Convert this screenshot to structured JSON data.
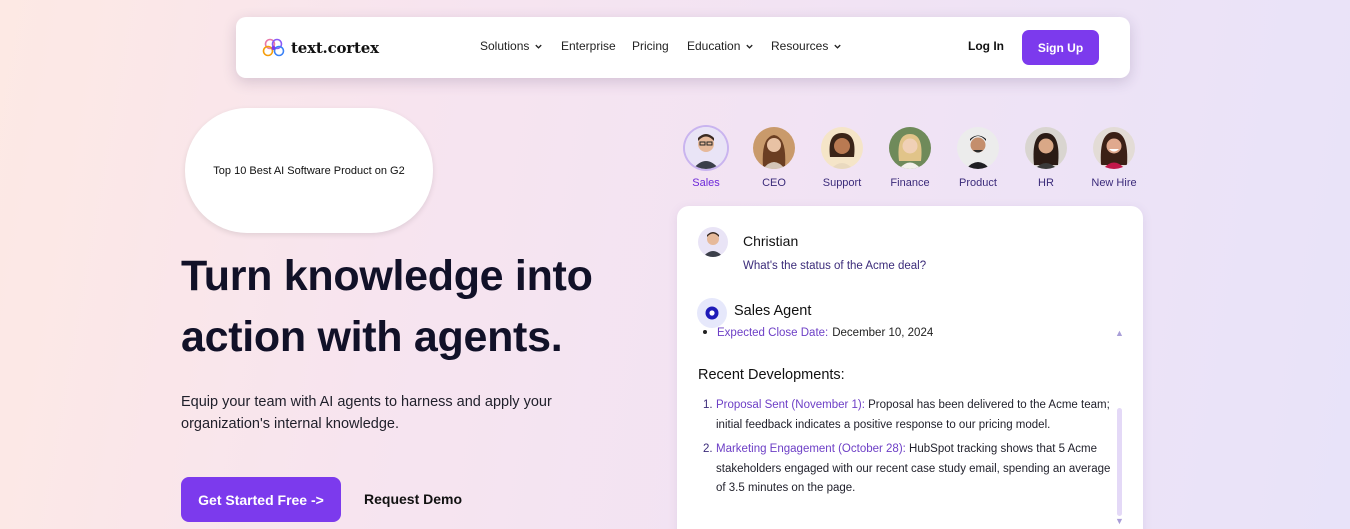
{
  "navbar": {
    "brand": "text.cortex",
    "items": [
      {
        "label": "Solutions",
        "has_dropdown": true
      },
      {
        "label": "Enterprise",
        "has_dropdown": false
      },
      {
        "label": "Pricing",
        "has_dropdown": false
      },
      {
        "label": "Education",
        "has_dropdown": true
      },
      {
        "label": "Resources",
        "has_dropdown": true
      }
    ],
    "login_label": "Log In",
    "signup_label": "Sign Up"
  },
  "badge": {
    "text": "Top 10 Best AI Software Product on G2"
  },
  "hero": {
    "title_line1": "Turn knowledge into",
    "title_line2": "action with agents.",
    "subtitle": "Equip your team with AI agents to harness and apply your organization's internal knowledge.",
    "primary_cta": "Get Started Free ->",
    "secondary_cta": "Request Demo"
  },
  "agents": {
    "active": "Sales",
    "items": [
      {
        "label": "Sales",
        "icon": "avatar-sales"
      },
      {
        "label": "CEO",
        "icon": "avatar-ceo"
      },
      {
        "label": "Support",
        "icon": "avatar-support"
      },
      {
        "label": "Finance",
        "icon": "avatar-finance"
      },
      {
        "label": "Product",
        "icon": "avatar-product"
      },
      {
        "label": "HR",
        "icon": "avatar-hr"
      },
      {
        "label": "New Hire",
        "icon": "avatar-new-hire"
      }
    ]
  },
  "chat": {
    "user_name": "Christian",
    "user_message": "What's the status of the Acme deal?",
    "agent_name": "Sales Agent",
    "close_date_label": "Expected Close Date:",
    "close_date_value": "December 10, 2024",
    "recent_heading": "Recent Developments:",
    "developments": [
      {
        "num": "1.",
        "title": "Proposal Sent (November 1):",
        "text": " Proposal has been delivered to the Acme team; initial feedback indicates a positive response to our pricing model."
      },
      {
        "num": "2.",
        "title": "Marketing Engagement (October 28):",
        "text": " HubSpot tracking shows that 5 Acme stakeholders engaged with our recent case study email, spending an average of 3.5 minutes on the page."
      }
    ]
  },
  "colors": {
    "accent": "#7c3aed",
    "link_purple": "#6d3fc6",
    "dark_text": "#111128"
  }
}
